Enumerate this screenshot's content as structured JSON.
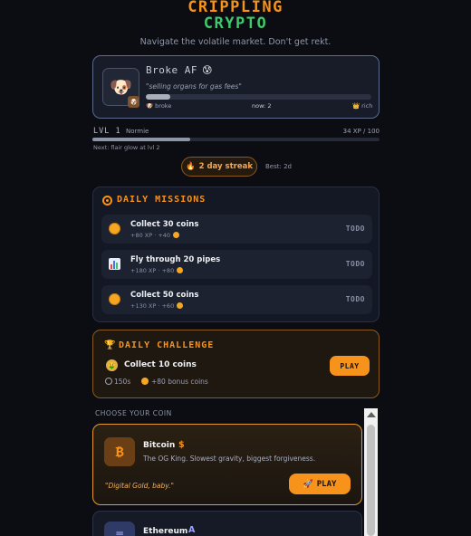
{
  "header": {
    "title_line1": "CRIPPLING",
    "title_line2": "CRYPTO",
    "tagline": "Navigate the volatile market. Don't get rekt."
  },
  "profile": {
    "avatar_emoji": "🐶",
    "badge_emoji": "🐶",
    "name": "Broke AF",
    "name_emoji": "😰",
    "quote": "\"selling organs for gas fees\"",
    "progress": 0.11,
    "label_left": "broke",
    "label_left_emoji": "🐶",
    "label_mid": "now: 2",
    "label_right": "rich",
    "label_right_emoji": "👑"
  },
  "level": {
    "label": "LVL",
    "number": "1",
    "name": "Normie",
    "xp": "34 XP / 100",
    "progress": 0.34,
    "next": "Next: flair glow at lvl 2"
  },
  "streak": {
    "icon": "flame-icon",
    "label": "2 day streak",
    "best": "Best: 2d"
  },
  "missions": {
    "title": "DAILY MISSIONS",
    "items": [
      {
        "title": "Collect 30 coins",
        "sub": "+80 XP · +40",
        "status": "TODO",
        "icon": "coin-icon"
      },
      {
        "title": "Fly through 20 pipes",
        "sub": "+180 XP · +80",
        "status": "TODO",
        "icon": "chart-icon"
      },
      {
        "title": "Collect 50 coins",
        "sub": "+130 XP · +60",
        "status": "TODO",
        "icon": "coin-icon"
      }
    ]
  },
  "challenge": {
    "title": "DAILY CHALLENGE",
    "task_emoji": "🤑",
    "task": "Collect 10 coins",
    "time": "150s",
    "bonus": "+80 bonus coins",
    "play": "PLAY"
  },
  "choose_label": "CHOOSE YOUR COIN",
  "coins": [
    {
      "icon_glyph": "₿",
      "name": "Bitcoin",
      "symbol": "$",
      "desc": "The OG King. Slowest gravity, biggest forgiveness.",
      "quote": "\"Digital Gold, baby.\"",
      "play": "PLAY",
      "play_icon": "🚀",
      "accent": "#f7931a"
    },
    {
      "icon_glyph": "≡",
      "name": "Ethereum",
      "symbol": "A",
      "accent": "#9aa4ff"
    }
  ],
  "colors": {
    "background": "#0b0d12",
    "orange": "#f7931a",
    "green": "#3ec96a"
  }
}
